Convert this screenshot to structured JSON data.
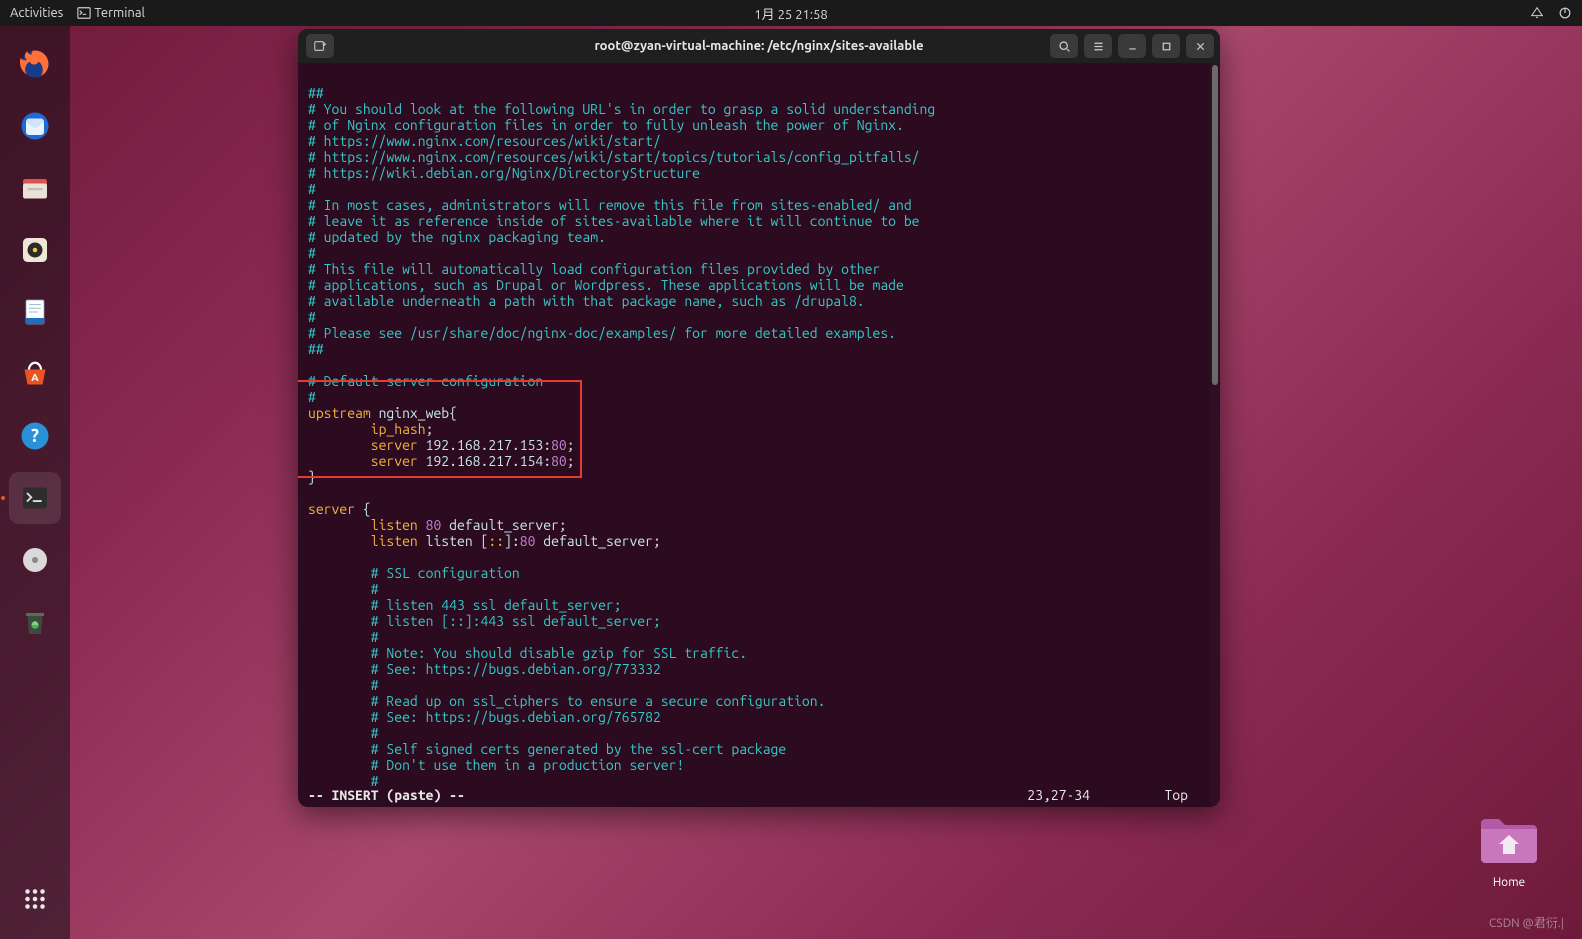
{
  "top": {
    "activities": "Activities",
    "app_label": "Terminal",
    "clock": "1月 25 21:58"
  },
  "dock": {
    "items": [
      {
        "name": "firefox"
      },
      {
        "name": "thunderbird"
      },
      {
        "name": "files"
      },
      {
        "name": "rhythmbox"
      },
      {
        "name": "libreoffice-writer"
      },
      {
        "name": "software"
      },
      {
        "name": "help"
      },
      {
        "name": "terminal"
      },
      {
        "name": "disc"
      },
      {
        "name": "trash"
      }
    ]
  },
  "desktop": {
    "home_label": "Home"
  },
  "terminal": {
    "title": "root@zyan-virtual-machine: /etc/nginx/sites-available",
    "status_mode": "-- INSERT (paste) --",
    "status_pos": "23,27-34",
    "status_loc": "Top",
    "comments": {
      "l0": "##",
      "l1": "# You should look at the following URL's in order to grasp a solid understanding",
      "l2": "# of Nginx configuration files in order to fully unleash the power of Nginx.",
      "l3": "# https://www.nginx.com/resources/wiki/start/",
      "l4": "# https://www.nginx.com/resources/wiki/start/topics/tutorials/config_pitfalls/",
      "l5": "# https://wiki.debian.org/Nginx/DirectoryStructure",
      "l6": "#",
      "l7": "# In most cases, administrators will remove this file from sites-enabled/ and",
      "l8": "# leave it as reference inside of sites-available where it will continue to be",
      "l9": "# updated by the nginx packaging team.",
      "l10": "#",
      "l11": "# This file will automatically load configuration files provided by other",
      "l12": "# applications, such as Drupal or Wordpress. These applications will be made",
      "l13": "# available underneath a path with that package name, such as /drupal8.",
      "l14": "#",
      "l15": "# Please see /usr/share/doc/nginx-doc/examples/ for more detailed examples.",
      "l16": "##",
      "l17": "",
      "l18": "# Default server configuration",
      "l19": "#"
    },
    "upstream": {
      "kw": "upstream",
      "name": " nginx_web{",
      "iphash_indent": "        ",
      "iphash": "ip_hash",
      "semi": ";",
      "s_indent": "        ",
      "server_kw": "server",
      "ip1": " 192.168.217.153:",
      "port1": "80",
      "ip2": " 192.168.217.154:",
      "port2": "80",
      "close": "}"
    },
    "server": {
      "blank": "",
      "kw": "server",
      "open": " {",
      "indent": "        ",
      "listen": "listen ",
      "p80": "80",
      "def": " default_server",
      "semi": ";",
      "listen6a": "listen [",
      "listen6b": "::",
      "listen6c": "]:",
      "c_blank": "        #",
      "c_ssl": "        # SSL configuration",
      "c_l443": "        # listen 443 ssl default_server;",
      "c_l443v6": "        # listen [::]:443 ssl default_server;",
      "c_note": "        # Note: You should disable gzip for SSL traffic.",
      "c_see1": "        # See: https://bugs.debian.org/773332",
      "c_read": "        # Read up on ssl_ciphers to ensure a secure configuration.",
      "c_see2": "        # See: https://bugs.debian.org/765782",
      "c_self": "        # Self signed certs generated by the ssl-cert package",
      "c_dont": "        # Don't use them in a production server!",
      "c_hash": "        #"
    }
  },
  "watermark": "CSDN @君衍.|"
}
